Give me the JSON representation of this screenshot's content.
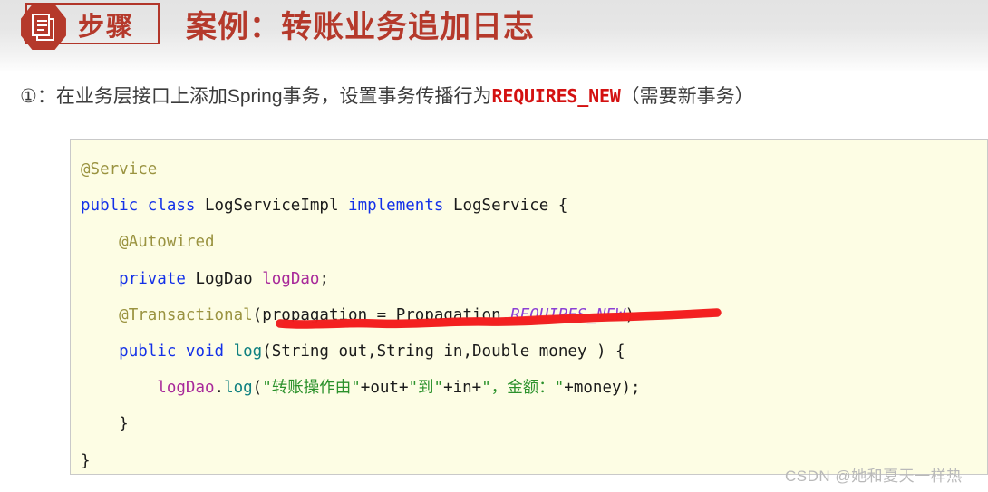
{
  "header": {
    "badge_icon": "document-hexagon-icon",
    "badge_label": "步骤",
    "title": "案例：转账业务追加日志",
    "accent_color": "#b5392b"
  },
  "subtitle": {
    "prefix": "①：在业务层接口上添加Spring事务，设置事务传播行为",
    "highlight": "REQUIRES_NEW",
    "highlight_color": "#d41111",
    "suffix": "（需要新事务）"
  },
  "code": {
    "language": "java",
    "background_color": "#fdfde4",
    "border_color": "#c9c9c9",
    "lines": [
      {
        "indent": 0,
        "tokens": [
          {
            "t": "@Service",
            "c": "ann"
          }
        ]
      },
      {
        "indent": 0,
        "tokens": [
          {
            "t": "public ",
            "c": "kw"
          },
          {
            "t": "class ",
            "c": "kw"
          },
          {
            "t": "LogServiceImpl ",
            "c": "type"
          },
          {
            "t": "implements ",
            "c": "kw"
          },
          {
            "t": "LogService {",
            "c": "type"
          }
        ]
      },
      {
        "indent": 1,
        "tokens": [
          {
            "t": "@Autowired",
            "c": "ann"
          }
        ]
      },
      {
        "indent": 1,
        "tokens": [
          {
            "t": "private ",
            "c": "kw"
          },
          {
            "t": "LogDao ",
            "c": "type"
          },
          {
            "t": "logDao",
            "c": "var"
          },
          {
            "t": ";",
            "c": "plain"
          }
        ]
      },
      {
        "indent": 1,
        "tokens": [
          {
            "t": "@Transactional",
            "c": "ann"
          },
          {
            "t": "(propagation = Propagation.",
            "c": "plain"
          },
          {
            "t": "REQUIRES_NEW",
            "c": "const"
          },
          {
            "t": ")",
            "c": "plain"
          }
        ]
      },
      {
        "indent": 1,
        "tokens": [
          {
            "t": "public ",
            "c": "kw"
          },
          {
            "t": "void ",
            "c": "kw"
          },
          {
            "t": "log",
            "c": "meth"
          },
          {
            "t": "(String out,String in,Double money ) {",
            "c": "plain"
          }
        ]
      },
      {
        "indent": 2,
        "tokens": [
          {
            "t": "logDao",
            "c": "var"
          },
          {
            "t": ".",
            "c": "plain"
          },
          {
            "t": "log",
            "c": "meth"
          },
          {
            "t": "(",
            "c": "plain"
          },
          {
            "t": "\"转账操作由\"",
            "c": "str"
          },
          {
            "t": "+out+",
            "c": "plain"
          },
          {
            "t": "\"到\"",
            "c": "str"
          },
          {
            "t": "+in+",
            "c": "plain"
          },
          {
            "t": "\"，金额：\"",
            "c": "str"
          },
          {
            "t": "+money);",
            "c": "plain"
          }
        ]
      },
      {
        "indent": 1,
        "tokens": [
          {
            "t": "}",
            "c": "plain"
          }
        ]
      },
      {
        "indent": 0,
        "tokens": [
          {
            "t": "}",
            "c": "plain"
          }
        ]
      }
    ]
  },
  "annotation": {
    "type": "hand-drawn-underline",
    "color": "#ef1c1c",
    "target_text": "(propagation = Propagation.REQUIRES_NEW)"
  },
  "watermark": {
    "text": "CSDN @她和夏天一样热"
  }
}
